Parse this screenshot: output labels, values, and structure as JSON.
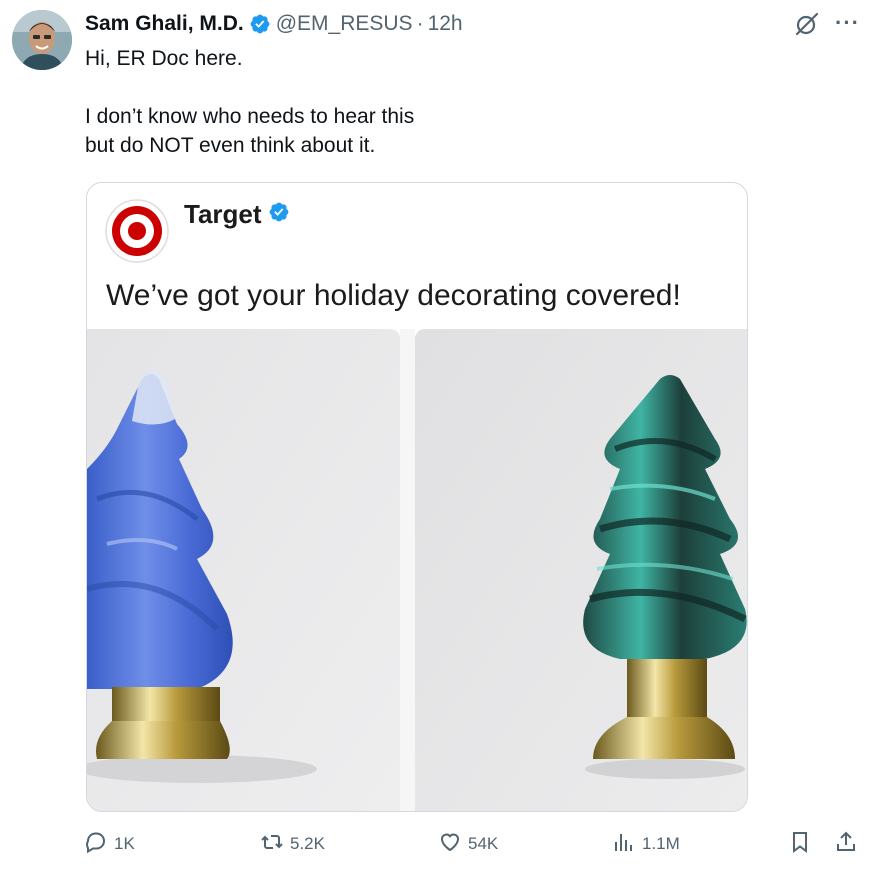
{
  "tweet": {
    "author_name": "Sam Ghali, M.D.",
    "handle": "@EM_RESUS",
    "separator": "·",
    "time": "12h",
    "text": "Hi, ER Doc here.\n\nI don’t know who needs to hear this\nbut do NOT even think about it."
  },
  "embedded": {
    "brand_name": "Target",
    "text": "We’ve got your holiday decorating covered!"
  },
  "actions": {
    "replies": "1K",
    "reposts": "5.2K",
    "likes": "54K",
    "views": "1.1M"
  },
  "icons": {
    "verified": "verified-badge-icon",
    "grok": "grok-icon",
    "more": "more-icon",
    "reply": "reply-icon",
    "repost": "repost-icon",
    "like": "heart-icon",
    "views": "views-icon",
    "bookmark": "bookmark-icon",
    "share": "share-icon"
  },
  "colors": {
    "verified_blue": "#1d9bf0",
    "secondary_text": "#536471",
    "target_red": "#cc0000"
  }
}
